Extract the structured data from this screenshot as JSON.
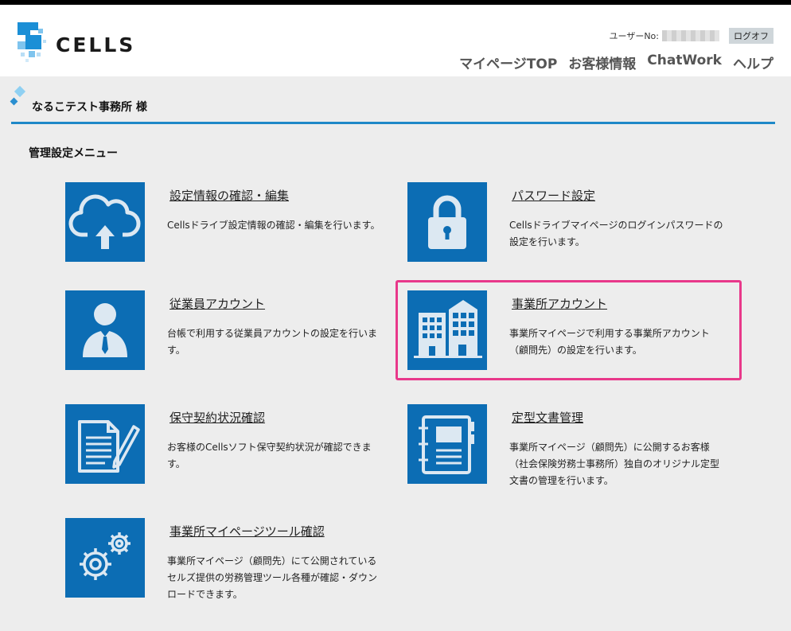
{
  "header": {
    "logo_text": "CELLS",
    "user_label": "ユーザーNo:",
    "logoff_label": "ログオフ",
    "nav": [
      "マイページTOP",
      "お客様情報",
      "ChatWork",
      "ヘルプ"
    ]
  },
  "client": {
    "name": "なるこテスト事務所 様"
  },
  "section": {
    "title": "管理設定メニュー"
  },
  "colors": {
    "tile": "#0c6db4",
    "accent_line": "#1e88c8",
    "highlight": "#e8388a"
  },
  "cards": [
    {
      "title": "設定情報の確認・編集",
      "desc": "Cellsドライブ設定情報の確認・編集を行います。",
      "icon": "cloud-upload-icon"
    },
    {
      "title": "パスワード設定",
      "desc": "Cellsドライブマイページのログインパスワードの設定を行います。",
      "icon": "lock-icon"
    },
    {
      "title": "従業員アカウント",
      "desc": "台帳で利用する従業員アカウントの設定を行います。",
      "icon": "employee-icon"
    },
    {
      "title": "事業所アカウント",
      "desc": "事業所マイページで利用する事業所アカウント（顧問先）の設定を行います。",
      "icon": "building-icon"
    },
    {
      "title": "保守契約状況確認",
      "desc": "お客様のCellsソフト保守契約状況が確認できます。",
      "icon": "document-pen-icon"
    },
    {
      "title": "定型文書管理",
      "desc": "事業所マイページ（顧問先）に公開するお客様（社会保険労務士事務所）独自のオリジナル定型文書の管理を行います。",
      "icon": "binder-icon"
    },
    {
      "title": "事業所マイページツール確認",
      "desc": "事業所マイページ（顧問先）にて公開されているセルズ提供の労務管理ツール各種が確認・ダウンロードできます。",
      "icon": "gears-icon"
    }
  ]
}
